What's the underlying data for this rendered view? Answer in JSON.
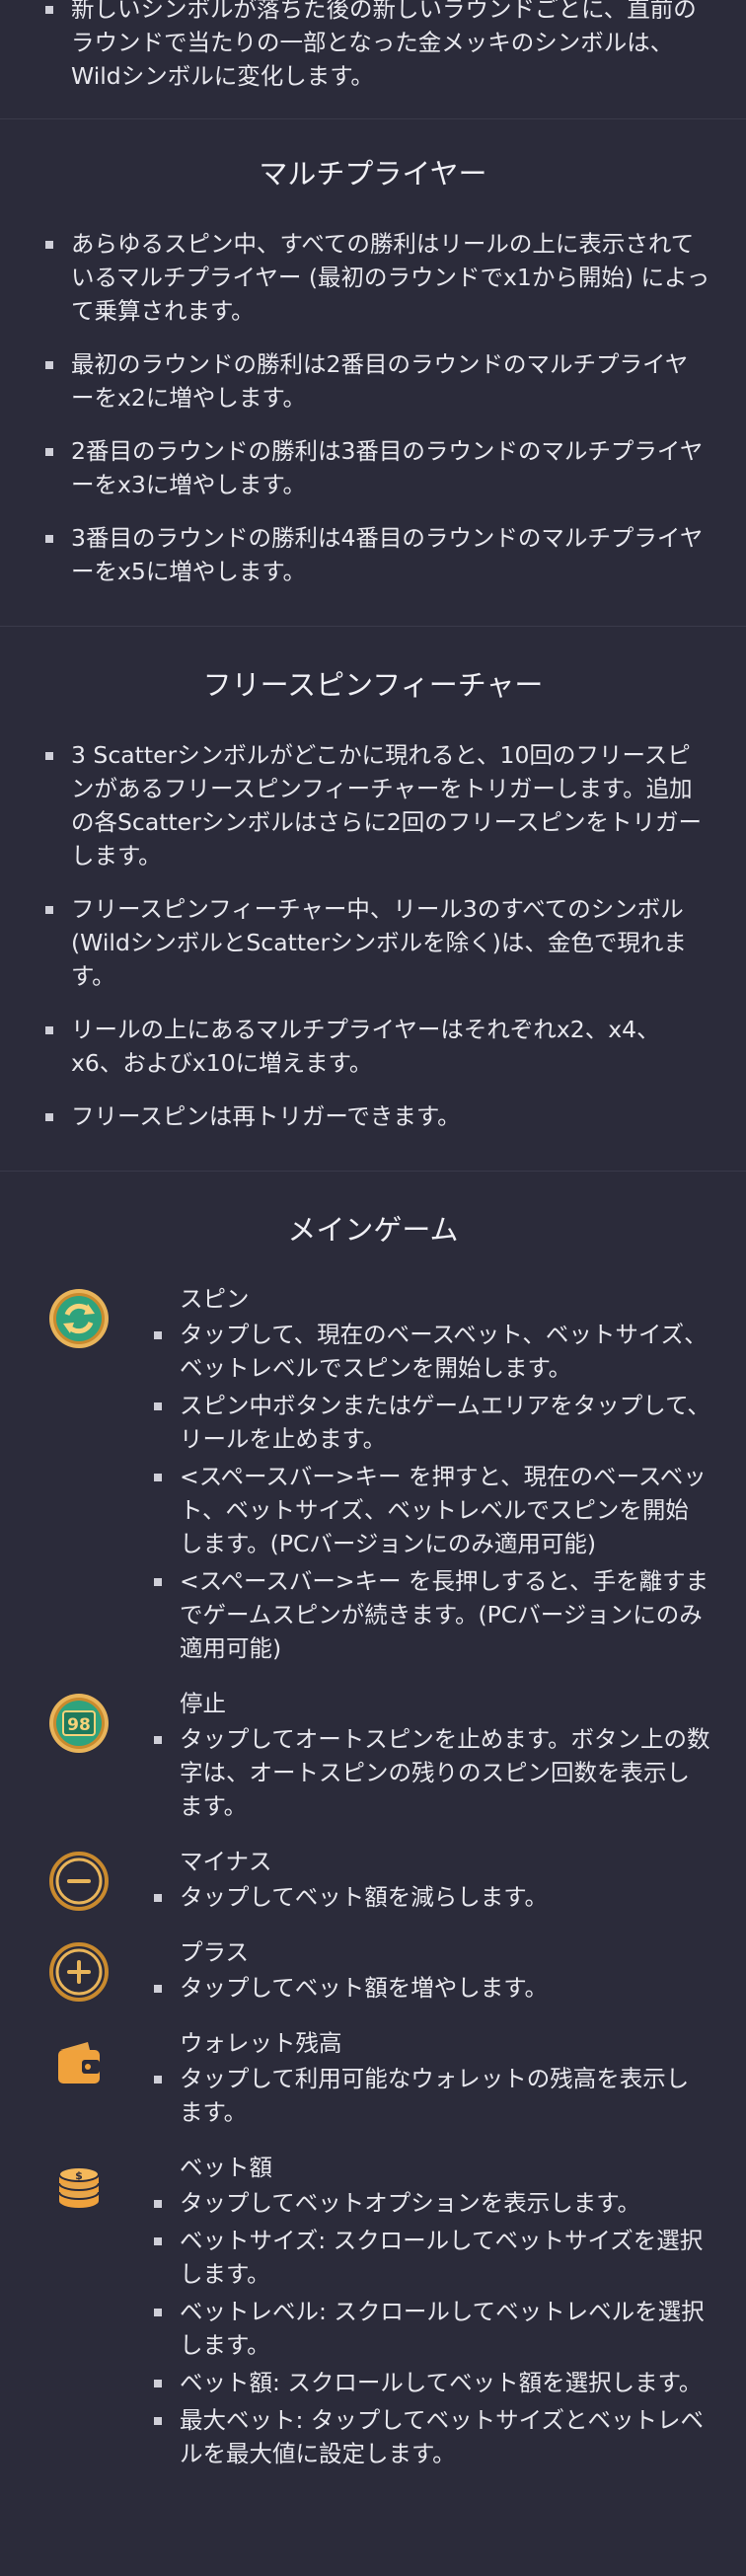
{
  "intro": {
    "items": [
      "新しいシンボルが落ちた後の新しいラウンドごとに、直前のラウンドで当たりの一部となった金メッキのシンボルは、Wildシンボルに変化します。"
    ]
  },
  "multiplier": {
    "title": "マルチプライヤー",
    "items": [
      "あらゆるスピン中、すべての勝利はリールの上に表示されているマルチプライヤー (最初のラウンドでx1から開始) によって乗算されます。",
      "最初のラウンドの勝利は2番目のラウンドのマルチプライヤーをx2に増やします。",
      "2番目のラウンドの勝利は3番目のラウンドのマルチプライヤーをx3に増やします。",
      "3番目のラウンドの勝利は4番目のラウンドのマルチプライヤーをx5に増やします。"
    ]
  },
  "freespin": {
    "title": "フリースピンフィーチャー",
    "items": [
      "3 Scatterシンボルがどこかに現れると、10回のフリースピンがあるフリースピンフィーチャーをトリガーします。追加の各Scatterシンボルはさらに2回のフリースピンをトリガーします。",
      "フリースピンフィーチャー中、リール3のすべてのシンボル (WildシンボルとScatterシンボルを除く)は、金色で現れます。",
      "リールの上にあるマルチプライヤーはそれぞれx2、x4、x6、およびx10に増えます。",
      "フリースピンは再トリガーできます。"
    ]
  },
  "main_game": {
    "title": "メインゲーム",
    "features": [
      {
        "icon": "spin-icon",
        "title": "スピン",
        "items": [
          "タップして、現在のベースベット、ベットサイズ、ベットレベルでスピンを開始します。",
          "スピン中ボタンまたはゲームエリアをタップして、リールを止めます。",
          "<スペースバー>キー を押すと、現在のベースベット、ベットサイズ、ベットレベルでスピンを開始します。(PCバージョンにのみ適用可能)",
          "<スペースバー>キー を長押しすると、手を離すまでゲームスピンが続きます。(PCバージョンにのみ適用可能)"
        ]
      },
      {
        "icon": "autospin-stop-icon",
        "icon_text": "98",
        "title": "停止",
        "items": [
          "タップしてオートスピンを止めます。ボタン上の数字は、オートスピンの残りのスピン回数を表示します。"
        ]
      },
      {
        "icon": "minus-icon",
        "title": "マイナス",
        "items": [
          "タップしてベット額を減らします。"
        ]
      },
      {
        "icon": "plus-icon",
        "title": "プラス",
        "items": [
          "タップしてベット額を増やします。"
        ]
      },
      {
        "icon": "wallet-icon",
        "title": "ウォレット残高",
        "items": [
          "タップして利用可能なウォレットの残高を表示します。"
        ]
      },
      {
        "icon": "coin-stack-icon",
        "title": "ベット額",
        "items": [
          "タップしてベットオプションを表示します。",
          "ベットサイズ: スクロールしてベットサイズを選択します。",
          "ベットレベル: スクロールしてベットレベルを選択します。",
          "ベット額: スクロールしてベット額を選択します。",
          "最大ベット: タップしてベットサイズとベットレベルを最大値に設定します。"
        ]
      }
    ]
  },
  "colors": {
    "background": "#2b2b3a",
    "text": "#e8e8ee",
    "icon_gold": "#e8a64a",
    "icon_green": "#2fa37d"
  }
}
